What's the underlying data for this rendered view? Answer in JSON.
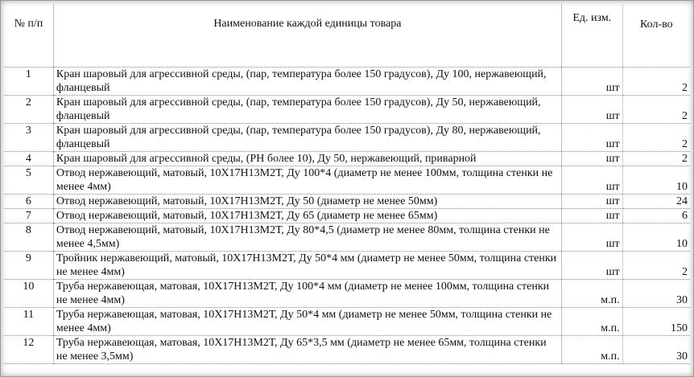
{
  "header": {
    "num": "№ п/п",
    "name": "Наименование каждой единицы товара",
    "unit": "Ед. изм.",
    "qty": "Кол-во"
  },
  "rows": [
    {
      "num": "1",
      "name": "Кран шаровый для агрессивной среды, (пар, температура более 150 градусов), Ду 100, нержавеющий, фланцевый",
      "unit": "шт",
      "qty": "2"
    },
    {
      "num": "2",
      "name": "Кран шаровый для агрессивной среды, (пар, температура более 150 градусов), Ду 50, нержавеющий, фланцевый",
      "unit": "шт",
      "qty": "2"
    },
    {
      "num": "3",
      "name": "Кран шаровый для агрессивной среды, (пар, температура более 150 градусов), Ду 80, нержавеющий, фланцевый",
      "unit": "шт",
      "qty": "2"
    },
    {
      "num": "4",
      "name": "Кран шаровый для агрессивной среды, (PH более 10), Ду 50, нержавеющий, приварной",
      "unit": "шт",
      "qty": "2"
    },
    {
      "num": "5",
      "name": "Отвод нержавеющий, матовый, 10Х17Н13М2Т, Ду 100*4 (диаметр не менее 100мм, толщина стенки не менее 4мм)",
      "unit": "шт",
      "qty": "10"
    },
    {
      "num": "6",
      "name": "Отвод нержавеющий, матовый, 10Х17Н13М2Т, Ду 50 (диаметр не менее 50мм)",
      "unit": "шт",
      "qty": "24"
    },
    {
      "num": "7",
      "name": "Отвод нержавеющий, матовый, 10Х17Н13М2Т, Ду 65 (диаметр не менее 65мм)",
      "unit": "шт",
      "qty": "6"
    },
    {
      "num": "8",
      "name": "Отвод нержавеющий, матовый, 10Х17Н13М2Т, Ду 80*4,5 (диаметр не менее 80мм, толщина стенки не менее 4,5мм)",
      "unit": "шт",
      "qty": "10"
    },
    {
      "num": "9",
      "name": "Тройник нержавеющий, матовый, 10Х17Н13М2Т, Ду 50*4 мм (диаметр не менее 50мм, толщина стенки не менее 4мм)",
      "unit": "шт",
      "qty": "2"
    },
    {
      "num": "10",
      "name": "Труба нержавеющая, матовая, 10Х17Н13М2Т, Ду 100*4 мм (диаметр не менее 100мм, толщина стенки не менее 4мм)",
      "unit": "м.п.",
      "qty": "30"
    },
    {
      "num": "11",
      "name": "Труба нержавеющая, матовая, 10Х17Н13М2Т, Ду 50*4 мм (диаметр не менее 50мм, толщина стенки не менее 4мм)",
      "unit": "м.п.",
      "qty": "150"
    },
    {
      "num": "12",
      "name": "Труба нержавеющая, матовая, 10Х17Н13М2Т, Ду 65*3,5 мм (диаметр не менее 65мм, толщина стенки не менее 3,5мм)",
      "unit": "м.п.",
      "qty": "30"
    }
  ]
}
